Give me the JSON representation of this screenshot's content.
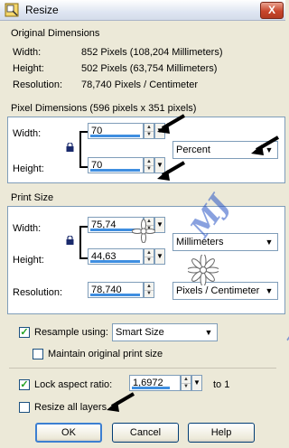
{
  "window": {
    "title": "Resize",
    "close_label": "X"
  },
  "original": {
    "heading": "Original Dimensions",
    "width_label": "Width:",
    "width_value": "852 Pixels (108,204 Millimeters)",
    "height_label": "Height:",
    "height_value": "502 Pixels (63,754 Millimeters)",
    "resolution_label": "Resolution:",
    "resolution_value": "78,740 Pixels / Centimeter"
  },
  "pixel_dimensions": {
    "heading": "Pixel Dimensions (596 pixels x 351 pixels)",
    "width_label": "Width:",
    "width_value": "70",
    "height_label": "Height:",
    "height_value": "70",
    "unit": "Percent"
  },
  "print_size": {
    "heading": "Print Size",
    "width_label": "Width:",
    "width_value": "75,74",
    "height_label": "Height:",
    "height_value": "44,63",
    "unit": "Millimeters",
    "resolution_label": "Resolution:",
    "resolution_value": "78,740",
    "resolution_unit": "Pixels / Centimeter"
  },
  "resample": {
    "label": "Resample using:",
    "checked": true,
    "method": "Smart Size",
    "maintain_label": "Maintain original print size",
    "maintain_checked": false
  },
  "aspect": {
    "label": "Lock aspect ratio:",
    "checked": true,
    "value": "1,6972",
    "suffix": "to 1"
  },
  "all_layers": {
    "label": "Resize all layers",
    "checked": false
  },
  "buttons": {
    "ok": "OK",
    "cancel": "Cancel",
    "help": "Help"
  },
  "watermark": "MJ Designs",
  "colors": {
    "accent": "#3f8ee0",
    "panel_highlight": "#ffffff",
    "dialog_bg": "#ece9d8"
  }
}
